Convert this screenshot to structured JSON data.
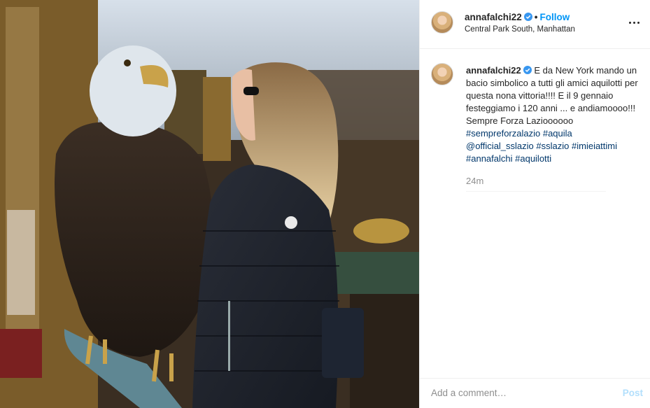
{
  "post": {
    "username": "annafalchi22",
    "follow_label": "Follow",
    "separator": "•",
    "location": "Central Park South, Manhattan",
    "caption": {
      "username": "annafalchi22",
      "text_1": "E da New York mando un bacio simbolico a tutti gli amici aquilotti per questa nona vittoria!!!! E il 9 gennaio festeggiamo i 120 anni ... e andiamoooo!!! Sempre Forza Lazioooooo ",
      "tags": [
        "#sempreforzalazio",
        "#aquila",
        "@official_sslazio",
        "#sslazio",
        "#imieiattimi",
        "#annafalchi",
        "#aquilotti"
      ]
    },
    "timestamp": "24m"
  },
  "comment_box": {
    "placeholder": "Add a comment…",
    "post_label": "Post"
  },
  "colors": {
    "link": "#0095f6",
    "hashtag": "#00376b",
    "verified": "#3897f0",
    "post_disabled": "#b2dffc"
  },
  "icons": {
    "verified": "verified-badge-icon",
    "more": "more-options-icon"
  }
}
